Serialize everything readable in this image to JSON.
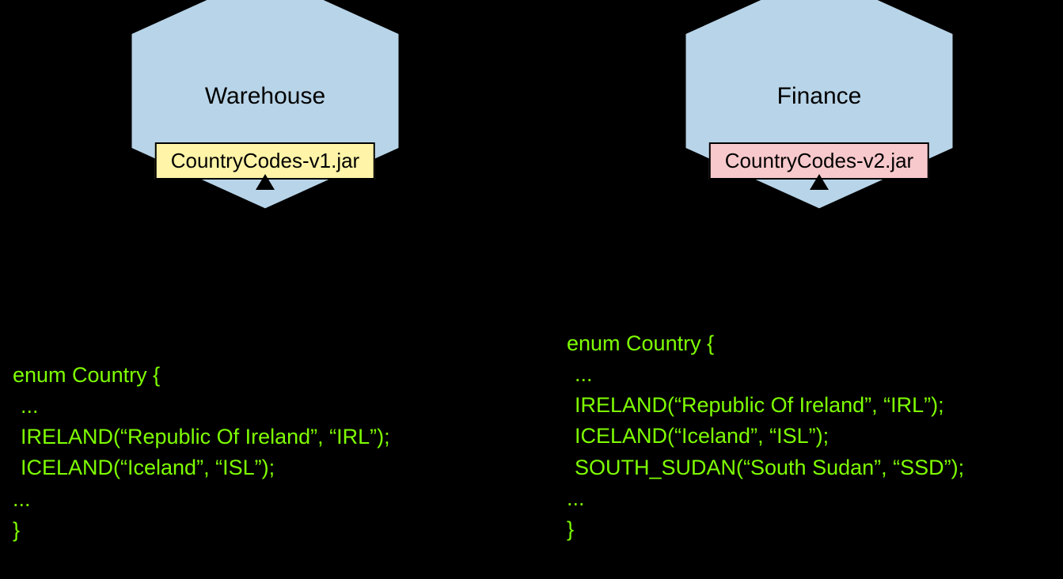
{
  "left": {
    "title": "Warehouse",
    "jar": "CountryCodes-v1.jar",
    "code": {
      "open": "enum Country {",
      "dots1": "...",
      "line1": "IRELAND(“Republic Of Ireland”, “IRL”);",
      "line2": "ICELAND(“Iceland”, “ISL”);",
      "dots2": "...",
      "close": "}"
    }
  },
  "right": {
    "title": "Finance",
    "jar": "CountryCodes-v2.jar",
    "code": {
      "open": "enum Country {",
      "dots1": "...",
      "line1": "IRELAND(“Republic Of Ireland”, “IRL”);",
      "line2": "ICELAND(“Iceland”, “ISL”);",
      "line3": "SOUTH_SUDAN(“South Sudan”, “SSD”);",
      "dots2": "...",
      "close": "}"
    }
  },
  "colors": {
    "hexFill": "#B8D4E8",
    "jarYellow": "#FFF4A8",
    "jarPink": "#F8C9CC",
    "codeGreen": "#7FFF00"
  }
}
